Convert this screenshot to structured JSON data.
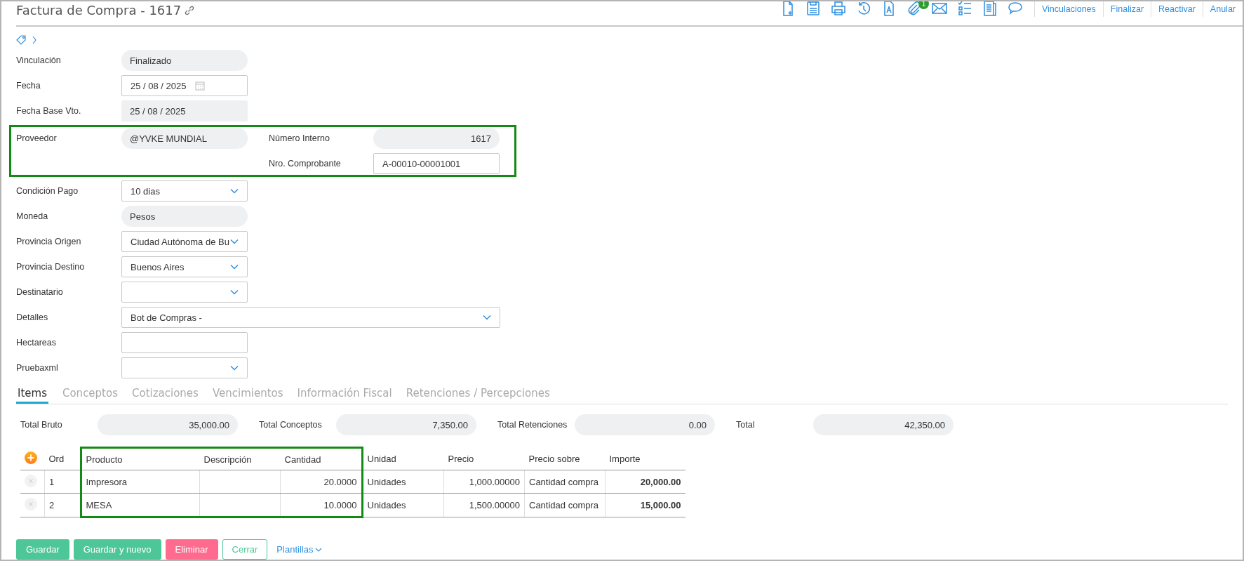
{
  "header": {
    "title": "Factura de Compra - 1617",
    "toolbar_badge": "1",
    "actions": [
      "Vinculaciones",
      "Finalizar",
      "Reactivar",
      "Anular"
    ]
  },
  "form": [
    {
      "highlighted": false,
      "columns": [
        [
          {
            "label": "Vinculación",
            "kind": "pill",
            "value": "Finalizado"
          },
          {
            "label": "Fecha",
            "kind": "date",
            "value": "25 / 08 / 2025"
          },
          {
            "label": "Fecha Base Vto.",
            "kind": "date-readonly",
            "value": "25 / 08 / 2025"
          }
        ]
      ]
    },
    {
      "highlighted": true,
      "columns": [
        [
          {
            "label": "Proveedor",
            "kind": "pill",
            "value": "@YVKE MUNDIAL"
          }
        ],
        [
          {
            "label": "Número Interno",
            "kind": "number-pill",
            "value": "1617"
          },
          {
            "label": "Nro. Comprobante",
            "kind": "input",
            "value": "A-00010-00001001"
          }
        ]
      ]
    },
    {
      "highlighted": false,
      "columns": [
        [
          {
            "label": "Condición Pago",
            "kind": "select",
            "value": "10 dias"
          },
          {
            "label": "Moneda",
            "kind": "pill",
            "value": "Pesos"
          },
          {
            "label": "Provincia Origen",
            "kind": "select",
            "value": "Ciudad Autónoma de Bu"
          },
          {
            "label": "Provincia Destino",
            "kind": "select",
            "value": "Buenos Aires"
          },
          {
            "label": "Destinatario",
            "kind": "select"
          },
          {
            "label": "Detalles",
            "kind": "select",
            "value": "Bot de Compras -",
            "wide": true
          },
          {
            "label": "Hectareas",
            "kind": "input"
          },
          {
            "label": "Pruebaxml",
            "kind": "select"
          }
        ]
      ]
    }
  ],
  "tabs": [
    {
      "label": "Items",
      "selected": true
    },
    {
      "label": "Conceptos",
      "selected": false
    },
    {
      "label": "Cotizaciones",
      "selected": false
    },
    {
      "label": "Vencimientos",
      "selected": false
    },
    {
      "label": "Información Fiscal",
      "selected": false
    },
    {
      "label": "Retenciones / Percepciones",
      "selected": false
    }
  ],
  "totals": [
    {
      "label": "Total Bruto",
      "value": "35,000.00"
    },
    {
      "label": "Total Conceptos",
      "value": "7,350.00"
    },
    {
      "label": "Total Retenciones",
      "value": "0.00"
    },
    {
      "label": "Total",
      "value": "42,350.00"
    }
  ],
  "table": {
    "columns": [
      {
        "label": "Ord",
        "kind": "text",
        "highlighted": false
      },
      {
        "label": "Producto",
        "kind": "text",
        "highlighted": true
      },
      {
        "label": "Descripción",
        "kind": "text",
        "highlighted": true
      },
      {
        "label": "Cantidad",
        "kind": "number",
        "highlighted": true
      },
      {
        "label": "Unidad",
        "kind": "text",
        "highlighted": false
      },
      {
        "label": "Precio",
        "kind": "number",
        "highlighted": false
      },
      {
        "label": "Precio sobre",
        "kind": "text",
        "highlighted": false
      },
      {
        "label": "Importe",
        "kind": "amount",
        "highlighted": false
      }
    ],
    "rows": [
      [
        "1",
        "Impresora",
        "",
        "20.0000",
        "Unidades",
        "1,000.00000",
        "Cantidad compra",
        "20,000.00"
      ],
      [
        "2",
        "MESA",
        "",
        "10.0000",
        "Unidades",
        "1,500.00000",
        "Cantidad compra",
        "15,000.00"
      ]
    ]
  },
  "buttons": [
    {
      "label": "Guardar",
      "kind": "primary"
    },
    {
      "label": "Guardar y nuevo",
      "kind": "primary"
    },
    {
      "label": "Eliminar",
      "kind": "danger"
    },
    {
      "label": "Cerrar",
      "kind": "outline"
    },
    {
      "label": "Plantillas",
      "kind": "dropdown-link"
    }
  ]
}
